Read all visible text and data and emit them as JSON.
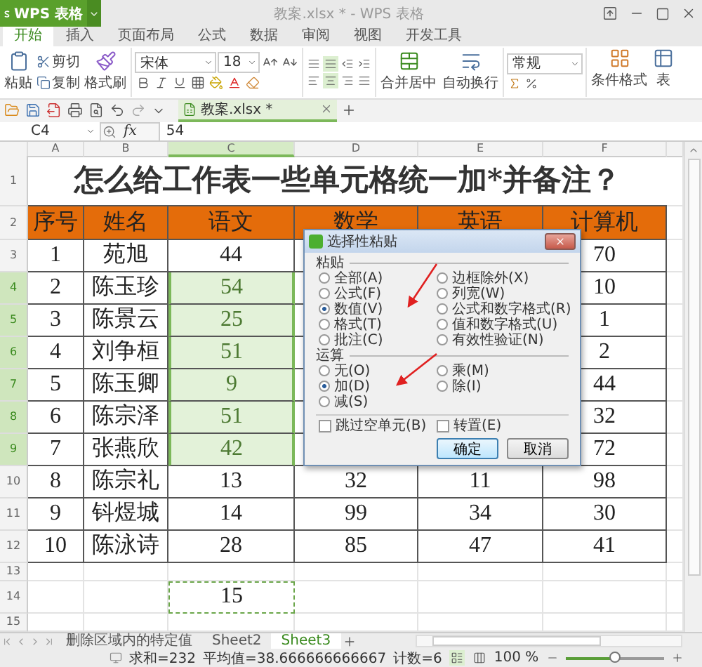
{
  "app_button": "WPS 表格",
  "window": {
    "title": "教案.xlsx * - WPS 表格"
  },
  "ribbon_tabs": [
    {
      "label": "开始",
      "selected": true
    },
    {
      "label": "插入",
      "selected": false
    },
    {
      "label": "页面布局",
      "selected": false
    },
    {
      "label": "公式",
      "selected": false
    },
    {
      "label": "数据",
      "selected": false
    },
    {
      "label": "审阅",
      "selected": false
    },
    {
      "label": "视图",
      "selected": false
    },
    {
      "label": "开发工具",
      "selected": false
    }
  ],
  "ribbon": {
    "paste": "粘贴",
    "cut": "剪切",
    "copy": "复制",
    "format_painter": "格式刷",
    "font": "宋体",
    "font_size": "18",
    "merge": "合并居中",
    "wrap": "自动换行",
    "number_format": "常规",
    "conditional": "条件格式",
    "table": "表"
  },
  "doc_tab": "教案.xlsx *",
  "formula_bar": {
    "cell": "C4",
    "fx": "fx",
    "value": "54"
  },
  "columns": [
    {
      "label": "A",
      "selected": false
    },
    {
      "label": "B",
      "selected": false
    },
    {
      "label": "C",
      "selected": true
    },
    {
      "label": "D",
      "selected": false
    },
    {
      "label": "E",
      "selected": false
    },
    {
      "label": "F",
      "selected": false
    }
  ],
  "grid_rows": [
    {
      "kind": "title",
      "number": "1",
      "selected": false,
      "text": "怎么给工作表一些单元格统一加*并备注？"
    },
    {
      "kind": "header",
      "number": "2",
      "selected": false,
      "cells": [
        "序号",
        "姓名",
        "语文",
        "数学",
        "英语",
        "计算机"
      ]
    },
    {
      "kind": "data",
      "number": "3",
      "selected": false,
      "cells": [
        "1",
        "苑旭",
        "44",
        null,
        null,
        "70"
      ]
    },
    {
      "kind": "data",
      "number": "4",
      "selected": true,
      "cells": [
        "2",
        "陈玉珍",
        "54",
        null,
        null,
        "10"
      ]
    },
    {
      "kind": "data",
      "number": "5",
      "selected": true,
      "cells": [
        "3",
        "陈景云",
        "25",
        null,
        null,
        "1"
      ]
    },
    {
      "kind": "data",
      "number": "6",
      "selected": true,
      "cells": [
        "4",
        "刘争桓",
        "51",
        null,
        null,
        "2"
      ]
    },
    {
      "kind": "data",
      "number": "7",
      "selected": true,
      "cells": [
        "5",
        "陈玉卿",
        "9",
        null,
        null,
        "44"
      ]
    },
    {
      "kind": "data",
      "number": "8",
      "selected": true,
      "cells": [
        "6",
        "陈宗泽",
        "51",
        null,
        null,
        "32"
      ]
    },
    {
      "kind": "data",
      "number": "9",
      "selected": true,
      "cells": [
        "7",
        "张燕欣",
        "42",
        null,
        null,
        "72"
      ]
    },
    {
      "kind": "data",
      "number": "10",
      "selected": false,
      "cells": [
        "8",
        "陈宗礼",
        "13",
        "32",
        "11",
        "98"
      ]
    },
    {
      "kind": "data",
      "number": "11",
      "selected": false,
      "cells": [
        "9",
        "钭煜城",
        "14",
        "99",
        "34",
        "30"
      ]
    },
    {
      "kind": "data",
      "number": "12",
      "selected": false,
      "cells": [
        "10",
        "陈泳诗",
        "28",
        "85",
        "47",
        "41"
      ]
    },
    {
      "kind": "blank",
      "number": "13",
      "selected": false
    },
    {
      "kind": "plain",
      "number": "14",
      "selected": false,
      "cells": [
        null,
        null,
        {
          "text": "15",
          "copied": true
        },
        null,
        null,
        null
      ]
    },
    {
      "kind": "blank",
      "number": "15",
      "selected": false
    }
  ],
  "dialog": {
    "title": "选择性粘贴",
    "paste_label": "粘贴",
    "paste_options": [
      {
        "label": "全部(A)",
        "selected": false
      },
      {
        "label": "公式(F)",
        "selected": false
      },
      {
        "label": "数值(V)",
        "selected": true
      },
      {
        "label": "格式(T)",
        "selected": false
      },
      {
        "label": "批注(C)",
        "selected": false
      },
      {
        "label": "边框除外(X)",
        "selected": false
      },
      {
        "label": "列宽(W)",
        "selected": false
      },
      {
        "label": "公式和数字格式(R)",
        "selected": false
      },
      {
        "label": "值和数字格式(U)",
        "selected": false
      },
      {
        "label": "有效性验证(N)",
        "selected": false
      }
    ],
    "operation_label": "运算",
    "operations": [
      {
        "label": "无(O)",
        "selected": false
      },
      {
        "label": "加(D)",
        "selected": true
      },
      {
        "label": "减(S)",
        "selected": false
      },
      {
        "label": "乘(M)",
        "selected": false
      },
      {
        "label": "除(I)",
        "selected": false
      }
    ],
    "checkboxes": [
      {
        "label": "跳过空单元(B)",
        "checked": false
      },
      {
        "label": "转置(E)",
        "checked": false
      }
    ],
    "buttons": [
      {
        "label": "确定",
        "default": true
      },
      {
        "label": "取消",
        "default": false
      }
    ]
  },
  "sheet_tabs": [
    {
      "label": "删除区域内的特定值",
      "selected": false
    },
    {
      "label": "Sheet2",
      "selected": false
    },
    {
      "label": "Sheet3",
      "selected": true
    }
  ],
  "status_bar": {
    "sum": "求和=232",
    "average": "平均值=38.666666666667",
    "count": "计数=6",
    "zoom": "100 %",
    "zoom_level": {
      "level": 0.5
    }
  }
}
